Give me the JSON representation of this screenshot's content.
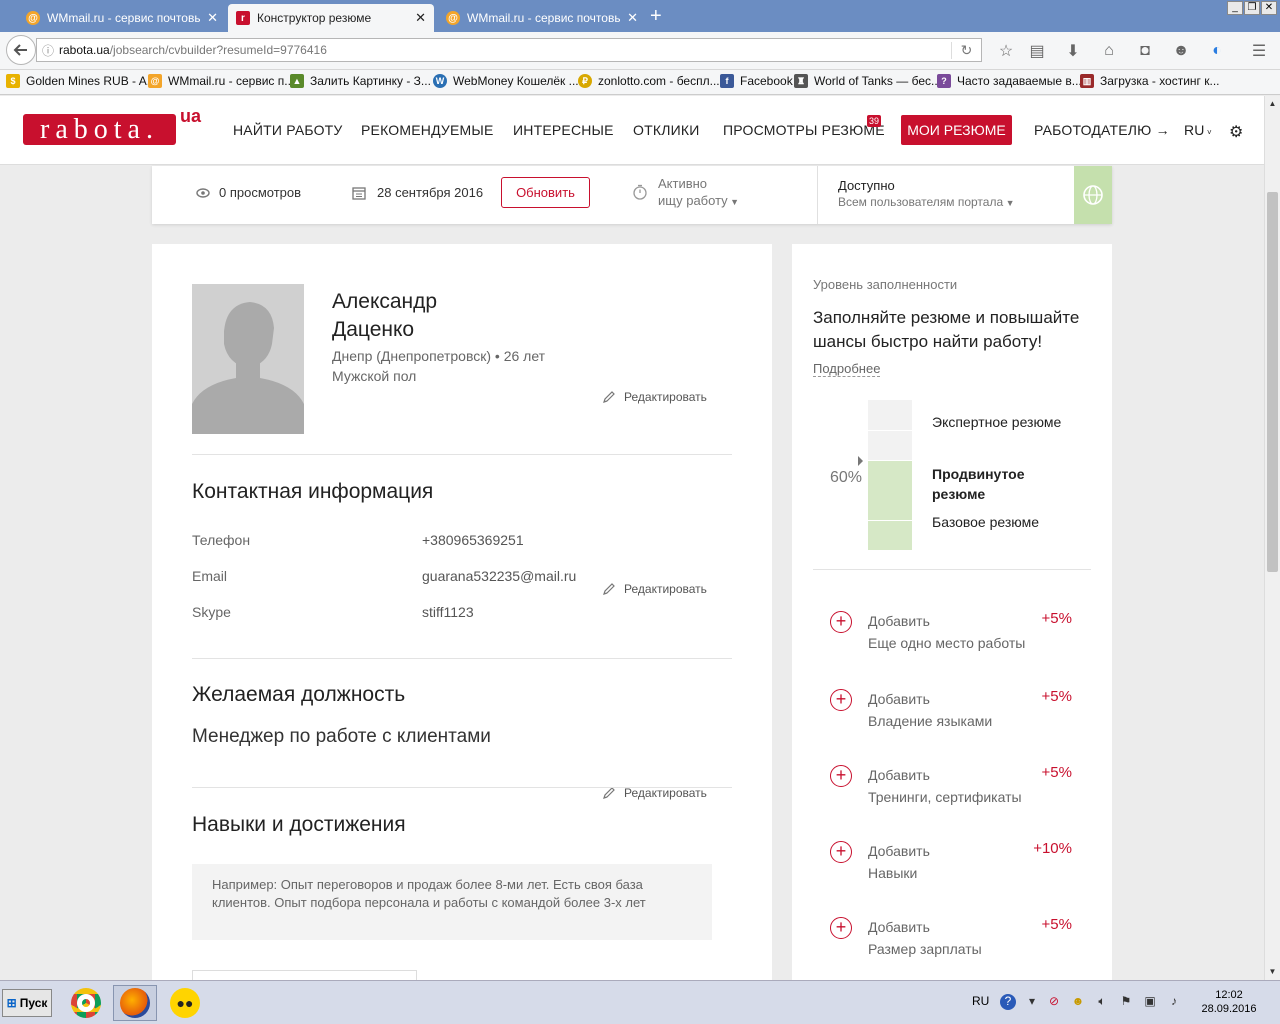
{
  "browser": {
    "tabs": [
      {
        "title": "WMmail.ru - сервис почтовы..."
      },
      {
        "title": "Конструктор резюме"
      },
      {
        "title": "WMmail.ru - сервис почтовы..."
      }
    ],
    "url_host": "rabota.ua",
    "url_path": "/jobsearch/cvbuilder?resumeId=9776416",
    "bookmarks": [
      {
        "label": "Golden Mines RUB - A...",
        "color": "#e8b200"
      },
      {
        "label": "WMmail.ru - сервис п...",
        "color": "#f3a52a"
      },
      {
        "label": "Залить Картинку - З...",
        "color": "#5a8a2a"
      },
      {
        "label": "WebMoney Кошелёк ...",
        "color": "#2a6fb3"
      },
      {
        "label": "zonlotto.com - беспл...",
        "color": "#d8a800"
      },
      {
        "label": "Facebook",
        "color": "#3b5998"
      },
      {
        "label": "World of Tanks — бес...",
        "color": "#555555"
      },
      {
        "label": "Часто задаваемые в...",
        "color": "#7a4a9a"
      },
      {
        "label": "Загрузка - хостинг к...",
        "color": "#9a2a2a"
      }
    ]
  },
  "site": {
    "logo_text": "rabota.",
    "logo_suffix": "ua",
    "nav": {
      "find_job": "НАЙТИ РАБОТУ",
      "recommended": "РЕКОМЕНДУЕМЫЕ",
      "interesting": "ИНТЕРЕСНЫЕ",
      "responses": "ОТКЛИКИ",
      "resume_views": "ПРОСМОТРЫ РЕЗЮМЕ",
      "resume_views_badge": "39",
      "my_resumes": "МОИ РЕЗЮМЕ",
      "employer": "РАБОТОДАТЕЛЮ →",
      "lang": "RU"
    },
    "brand_color": "#c8102e"
  },
  "status": {
    "views": "0 просмотров",
    "date": "28 сентября 2016",
    "refresh": "Обновить",
    "active_label": "Активно",
    "active_value": "ищу работу",
    "access_label": "Доступно",
    "access_value": "Всем пользователям портала"
  },
  "profile": {
    "first_name": "Александр",
    "last_name": "Даценко",
    "location": "Днепр (Днепропетровск) • 26 лет",
    "gender": "Мужской пол",
    "edit": "Редактировать"
  },
  "contacts": {
    "title": "Контактная информация",
    "rows": [
      {
        "label": "Телефон",
        "value": "+380965369251"
      },
      {
        "label": "Email",
        "value": "guarana532235@mail.ru"
      },
      {
        "label": "Skype",
        "value": "stiff1123"
      }
    ]
  },
  "position": {
    "title": "Желаемая должность",
    "value": "Менеджер по работе с клиентами"
  },
  "skills": {
    "title": "Навыки и достижения",
    "placeholder": "Например: Опыт переговоров и продаж более 8-ми лет. Есть своя база клиентов. Опыт подбора персонала и работы с командой более 3-х лет"
  },
  "sidebar": {
    "level_title": "Уровень заполненности",
    "headline": "Заполняйте резюме и повышайте шансы быстро найти работу!",
    "more": "Подробнее",
    "percent": "60%",
    "fill_fraction": 0.6,
    "levels": [
      "Экспертное резюме",
      "Продвинутое резюме",
      "Базовое резюме"
    ],
    "add_items": [
      {
        "action": "Добавить",
        "label": "Еще одно место работы",
        "bonus": "+5%"
      },
      {
        "action": "Добавить",
        "label": "Владение языками",
        "bonus": "+5%"
      },
      {
        "action": "Добавить",
        "label": "Тренинги, сертификаты",
        "bonus": "+5%"
      },
      {
        "action": "Добавить",
        "label": "Навыки",
        "bonus": "+10%"
      },
      {
        "action": "Добавить",
        "label": "Размер зарплаты",
        "bonus": "+5%"
      }
    ]
  },
  "taskbar": {
    "start": "Пуск",
    "lang": "RU",
    "time": "12:02",
    "date": "28.09.2016"
  }
}
